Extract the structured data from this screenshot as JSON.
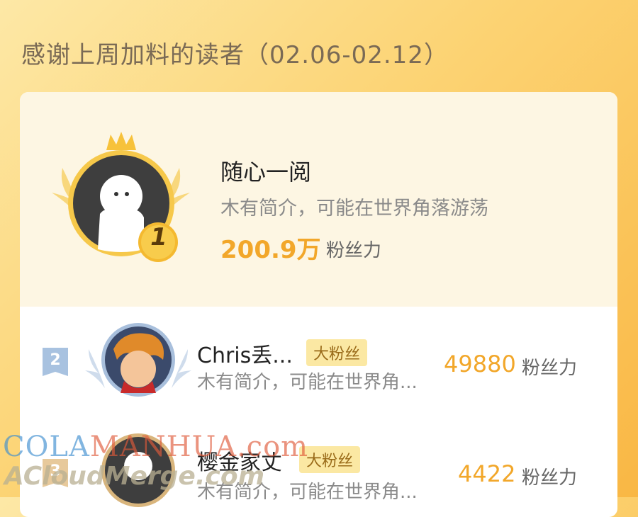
{
  "header": {
    "title": "感谢上周加料的读者（02.06-02.12）"
  },
  "top_reader": {
    "rank": "1",
    "name": "随心一阅",
    "bio": "木有简介，可能在世界角落游荡",
    "score": "200.9万",
    "score_unit": "粉丝力"
  },
  "readers": [
    {
      "rank": "2",
      "name": "Chris丢...",
      "badge": "大粉丝",
      "bio": "木有简介，可能在世界角...",
      "score": "49880",
      "score_unit": "粉丝力"
    },
    {
      "rank": "3",
      "name": "樱金家丈",
      "badge": "大粉丝",
      "bio": "木有简介，可能在世界角...",
      "score": "4422",
      "score_unit": "粉丝力"
    }
  ],
  "watermark": {
    "line1_part1": "COLA",
    "line1_part2": "MANHUA",
    "line1_part3": ".com",
    "line2": "ACloudMerge.com"
  },
  "colors": {
    "accent": "#f2a72a",
    "badge_bg": "#fbe8a3",
    "rank2": "#a8c2e0"
  }
}
